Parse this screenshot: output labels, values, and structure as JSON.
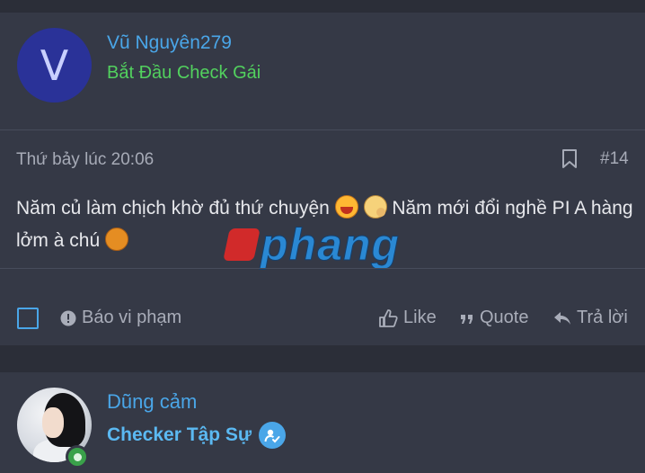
{
  "post1": {
    "avatar_letter": "V",
    "username": "Vũ Nguyên279",
    "user_title": "Bắt Đầu Check Gái",
    "date": "Thứ bảy lúc 20:06",
    "post_number": "#14",
    "message_part1": "Năm củ làm chịch khờ đủ thứ chuyện ",
    "message_part2": " Năm mới đổi nghề PI A hàng lởm à chú ",
    "actions": {
      "report": "Báo vi phạm",
      "like": "Like",
      "quote": "Quote",
      "reply": "Trả lời"
    }
  },
  "watermark": {
    "text": "phang"
  },
  "post2": {
    "username": "Dũng cảm",
    "user_title": "Checker Tập Sự"
  },
  "icons": [
    "bookmark-icon",
    "exclamation-circle-icon",
    "thumbs-up-icon",
    "quote-icon",
    "reply-arrow-icon",
    "online-status-icon",
    "verified-badge-icon"
  ],
  "colors": {
    "background": "#2b2e38",
    "card": "#353946",
    "username": "#4aa6e8",
    "title_green": "#52d15e",
    "muted": "#a7abb7"
  }
}
